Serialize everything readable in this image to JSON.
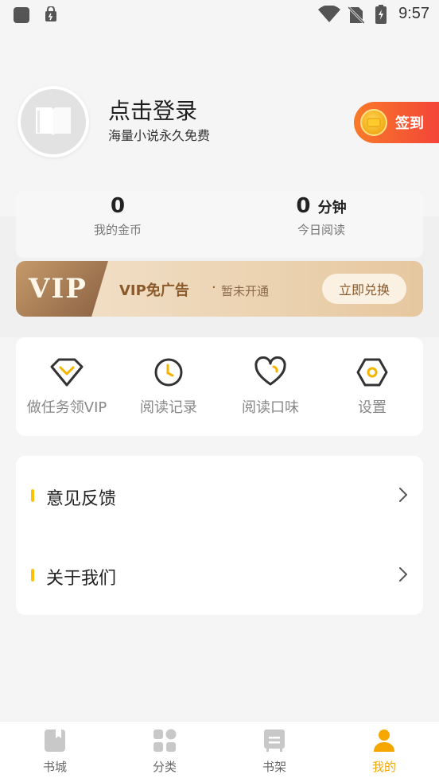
{
  "status_bar": {
    "time": "9:57",
    "icons": [
      "app-notification-icon",
      "lock-notification-icon",
      "wifi-icon",
      "no-sim-icon",
      "battery-charging-icon"
    ]
  },
  "profile": {
    "login_title": "点击登录",
    "login_subtitle": "海量小说永久免费",
    "signin_label": "签到",
    "avatar_icon": "book-icon"
  },
  "stats": {
    "coins_value": "0",
    "coins_label": "我的金币",
    "reading_value": "0",
    "reading_unit": "分钟",
    "reading_label": "今日阅读"
  },
  "vip": {
    "badge": "VIP",
    "title": "VIP免广告",
    "dot": "·",
    "status": "暂未开通",
    "button": "立即兑换"
  },
  "actions": [
    {
      "label": "做任务领VIP",
      "icon": "diamond-icon"
    },
    {
      "label": "阅读记录",
      "icon": "clock-icon"
    },
    {
      "label": "阅读口味",
      "icon": "heart-icon"
    },
    {
      "label": "设置",
      "icon": "settings-hex-icon"
    }
  ],
  "list": [
    {
      "label": "意见反馈"
    },
    {
      "label": "关于我们"
    }
  ],
  "nav": [
    {
      "label": "书城",
      "icon": "bookstore-icon"
    },
    {
      "label": "分类",
      "icon": "category-icon"
    },
    {
      "label": "书架",
      "icon": "bookshelf-icon"
    },
    {
      "label": "我的",
      "icon": "profile-icon"
    }
  ],
  "colors": {
    "accent": "#f5a700",
    "signin_gradient_start": "#f97a28",
    "signin_gradient_end": "#f3433a",
    "vip_text": "#8b5a2b",
    "list_marker": "#ffc107"
  }
}
